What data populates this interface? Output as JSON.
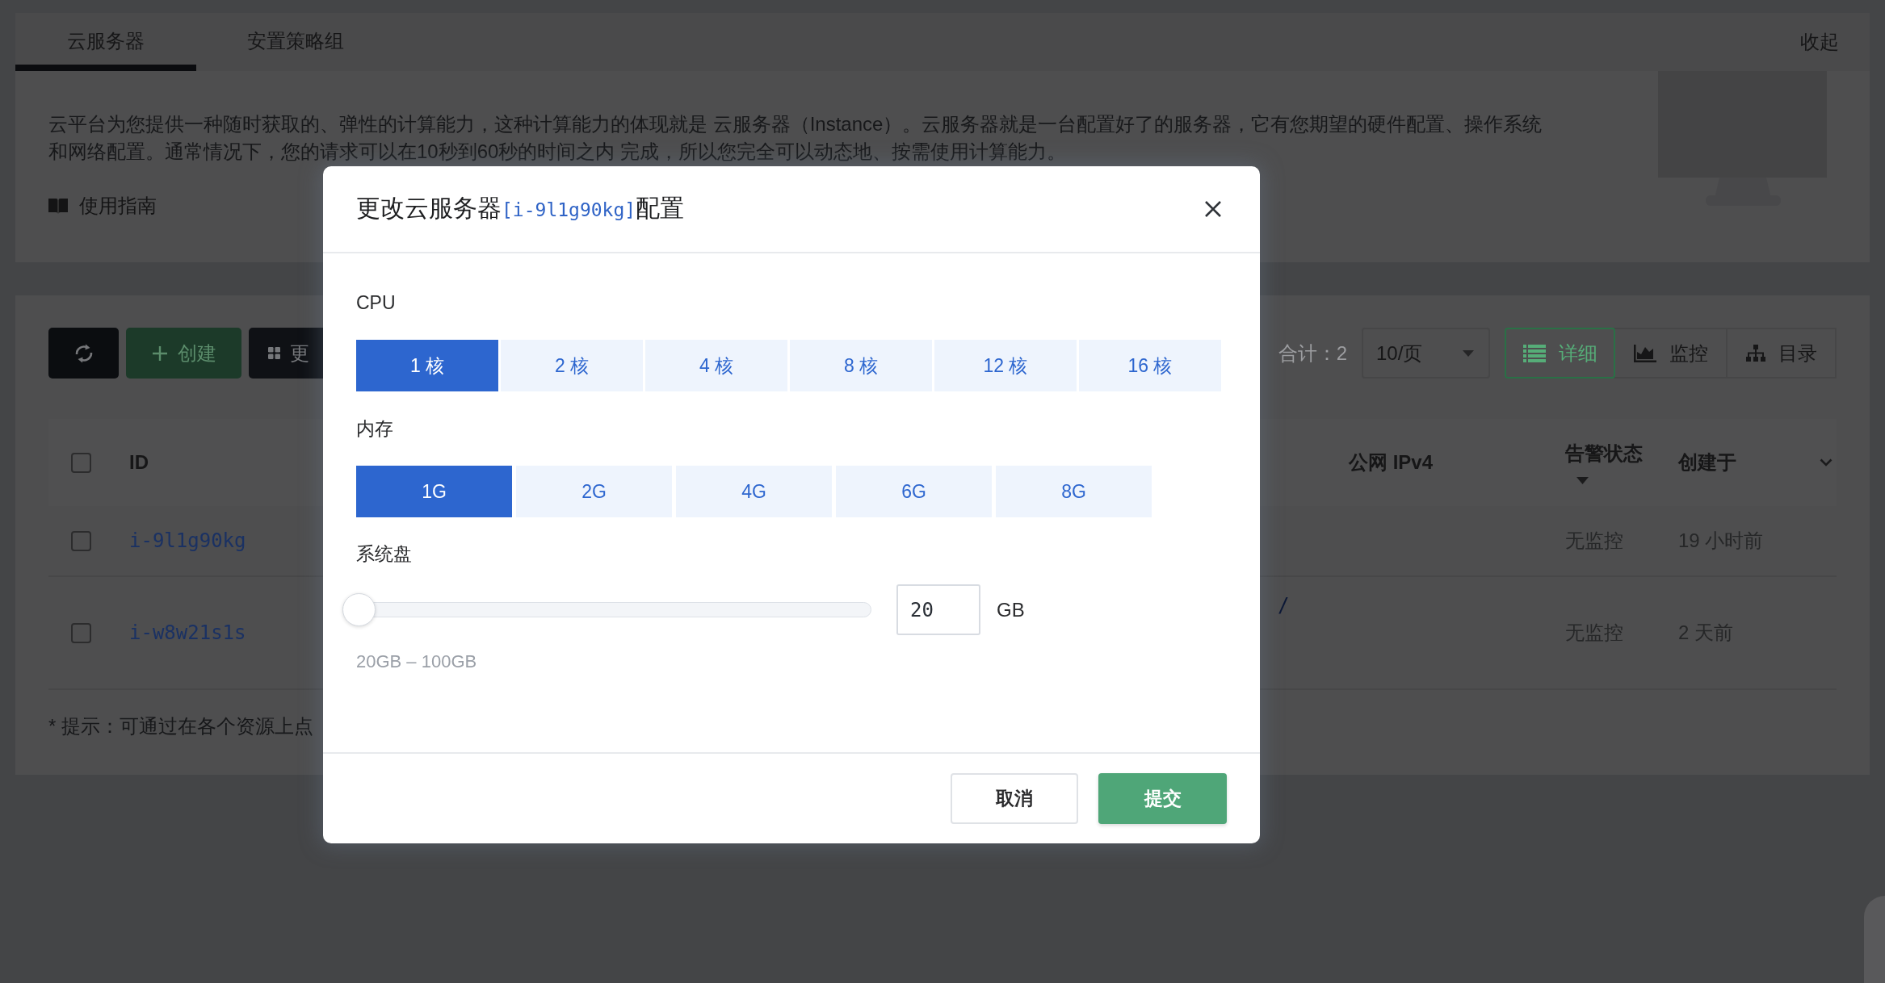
{
  "tabs": [
    {
      "label": "云服务器",
      "selected": true
    },
    {
      "label": "安置策略组",
      "selected": false
    }
  ],
  "collapse": "收起",
  "intro": {
    "text": "云平台为您提供一种随时获取的、弹性的计算能力，这种计算能力的体现就是 云服务器（Instance）。云服务器就是一台配置好了的服务器，它有您期望的硬件配置、操作系统和网络配置。通常情况下，您的请求可以在10秒到60秒的时间之内 完成，所以您完全可以动态地、按需使用计算能力。",
    "guide": "使用指南"
  },
  "toolbar": {
    "buttons": [
      {
        "kind": "refresh"
      },
      {
        "kind": "create",
        "label": "创建"
      },
      {
        "kind": "more",
        "label": "更"
      }
    ],
    "total": "合计：2",
    "page_size": "10/页",
    "views": [
      {
        "label": "详细",
        "selected": true
      },
      {
        "label": "监控",
        "selected": false
      },
      {
        "label": "目录",
        "selected": false
      }
    ]
  },
  "table": {
    "select_all": {
      "checked": false
    },
    "columns": [
      {
        "label": "ID"
      },
      {
        "label": "公网 IPv4"
      },
      {
        "label": "告警状态"
      },
      {
        "label": "创建于"
      }
    ],
    "rows": [
      {
        "checked": false,
        "id": "i-9l1g90kg",
        "alert": "无监控",
        "created": "19 小时前"
      },
      {
        "checked": false,
        "id": "i-w8w21s1s",
        "column_3": "/",
        "alert": "无监控",
        "created": "2 天前"
      }
    ]
  },
  "hint": "* 提示：可通过在各个资源上点",
  "dialog": {
    "title_prefix": "更改云服务器",
    "instance_id": "[i-9l1g90kg]",
    "title_suffix": "配置",
    "cpu": {
      "label": "CPU",
      "options": [
        {
          "label": "1 核",
          "selected": true
        },
        {
          "label": "2 核",
          "selected": false
        },
        {
          "label": "4 核",
          "selected": false
        },
        {
          "label": "8 核",
          "selected": false
        },
        {
          "label": "12 核",
          "selected": false
        },
        {
          "label": "16 核",
          "selected": false
        }
      ]
    },
    "memory": {
      "label": "内存",
      "options": [
        {
          "label": "1G",
          "selected": true
        },
        {
          "label": "2G",
          "selected": false
        },
        {
          "label": "4G",
          "selected": false
        },
        {
          "label": "6G",
          "selected": false
        },
        {
          "label": "8G",
          "selected": false
        }
      ]
    },
    "disk": {
      "label": "系统盘",
      "level": 0,
      "value": "20",
      "unit": "GB",
      "range": "20GB – 100GB"
    },
    "buttons": [
      {
        "kind": "cancel",
        "label": "取消"
      },
      {
        "kind": "submit",
        "label": "提交"
      }
    ]
  }
}
